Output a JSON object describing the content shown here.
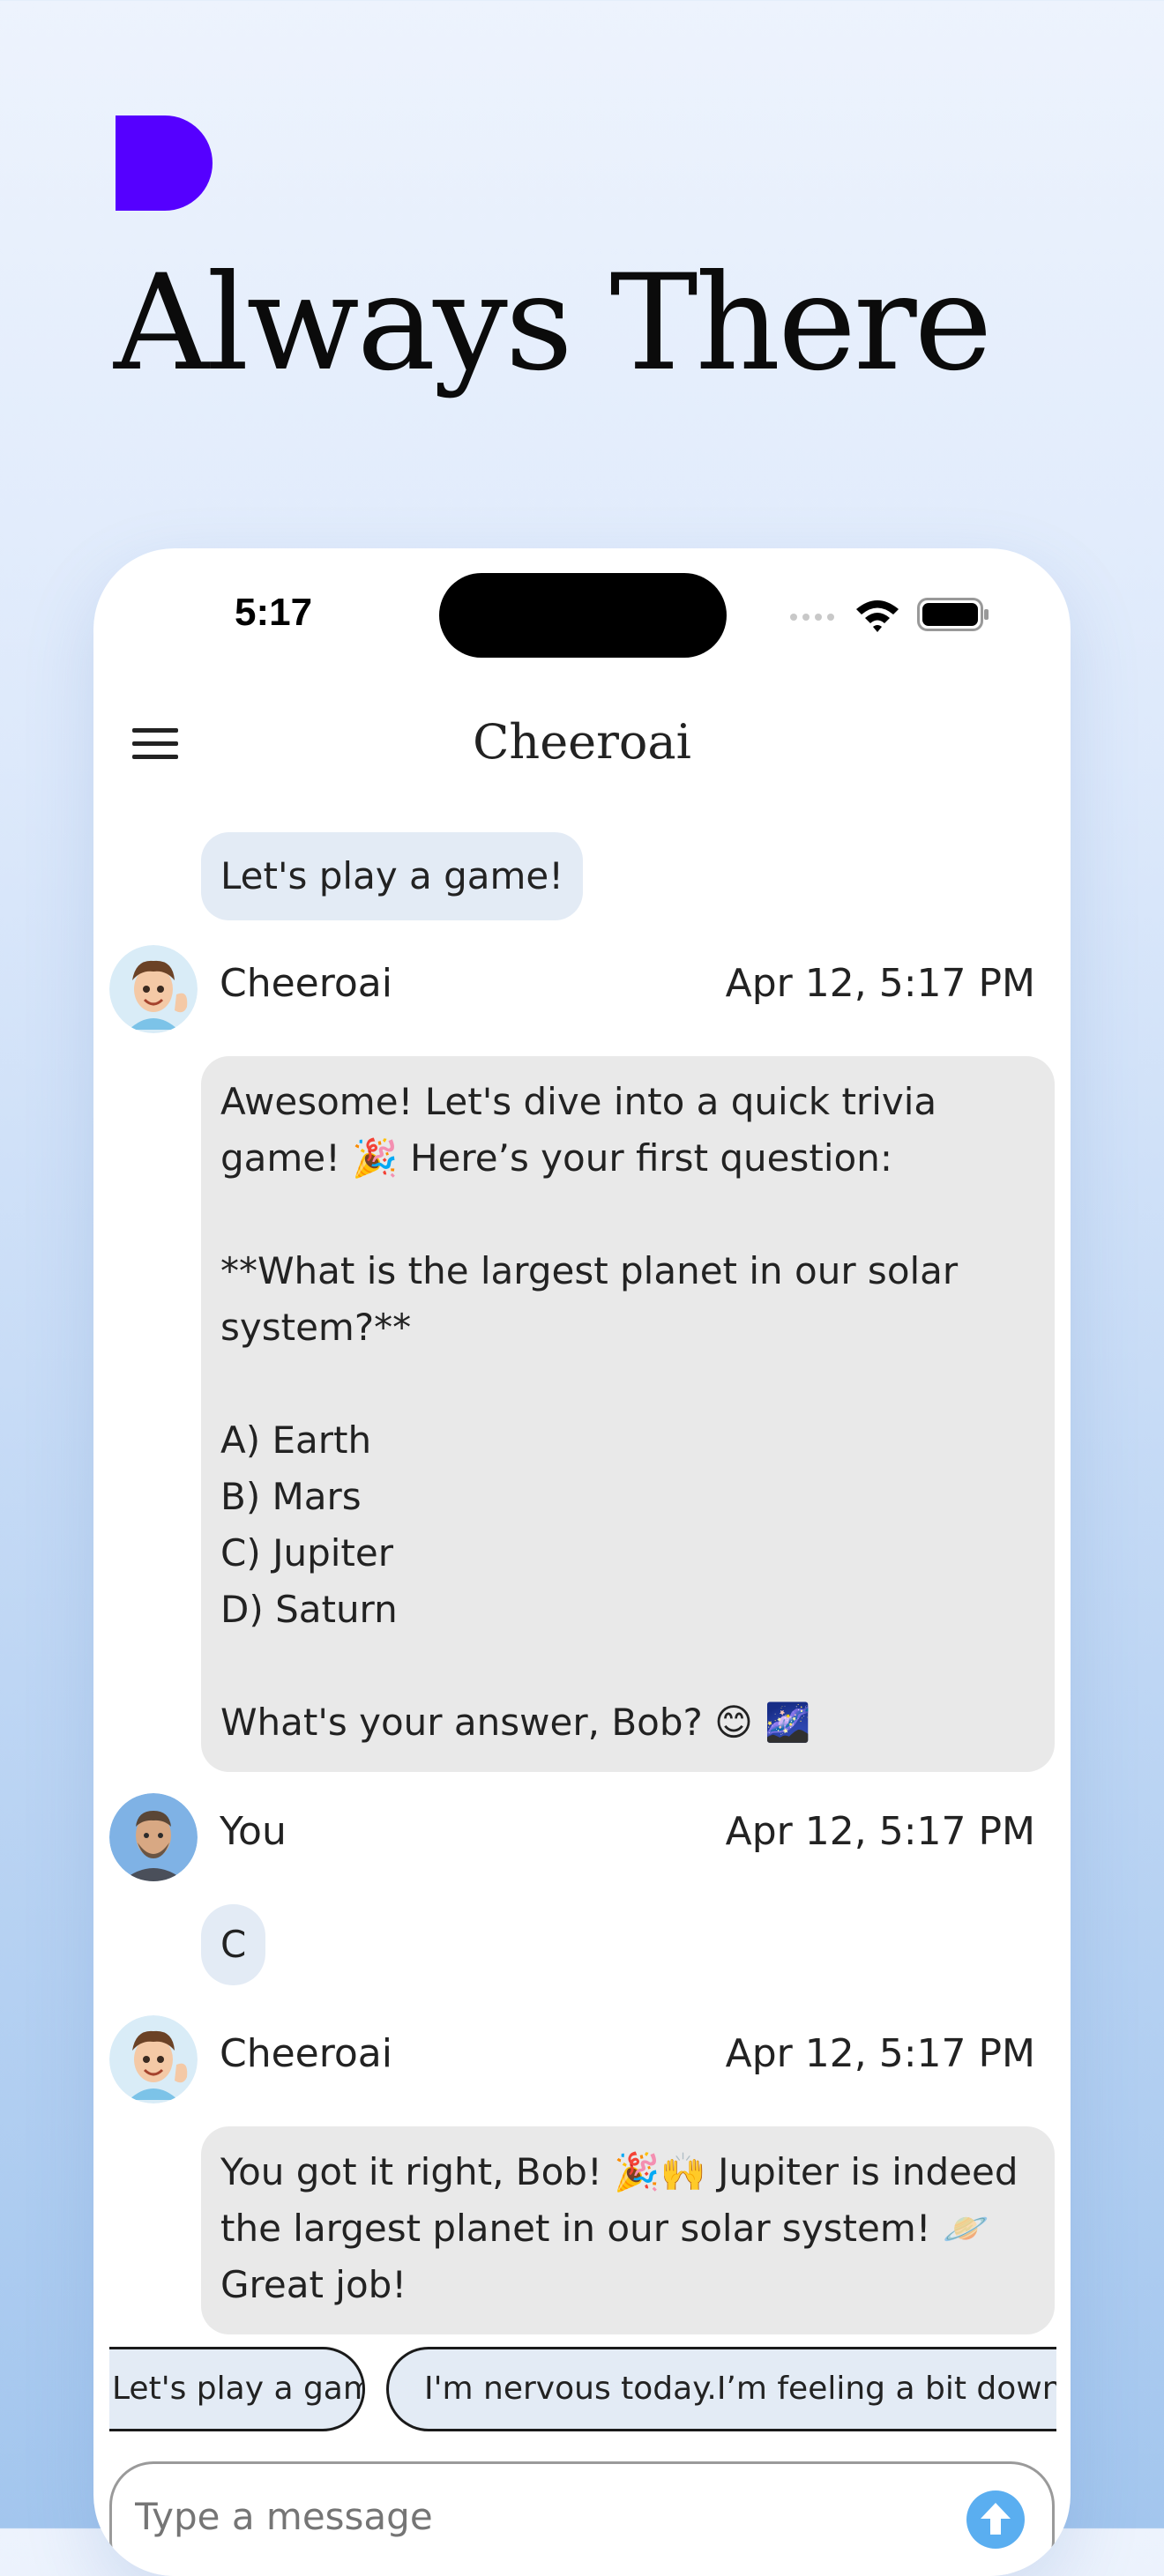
{
  "colors": {
    "brand_logo": "#5500ff",
    "user_bubble": "#e3ebf5",
    "bot_bubble": "#e9e9e9",
    "send_button": "#5aaef0"
  },
  "hero": {
    "title": "Always There"
  },
  "status_bar": {
    "time": "5:17"
  },
  "app_bar": {
    "title": "Cheeroai",
    "menu_icon": "hamburger-menu-icon"
  },
  "chat": {
    "messages": [
      {
        "type": "user",
        "text": "Let's play a game!"
      },
      {
        "type": "bot",
        "sender": "Cheeroai",
        "time": "Apr 12, 5:17 PM",
        "text": "Awesome! Let's dive into a quick trivia game! 🎉 Here’s your first question:\n\n**What is the largest planet in our solar system?**\n\nA) Earth\nB) Mars\nC) Jupiter\nD) Saturn\n\nWhat's your answer, Bob? 😊 🌌"
      },
      {
        "type": "user",
        "sender": "You",
        "time": "Apr 12, 5:17 PM",
        "text": "C"
      },
      {
        "type": "bot",
        "sender": "Cheeroai",
        "time": "Apr 12, 5:17 PM",
        "text": "You got it right, Bob! 🎉🙌 Jupiter is indeed the largest planet in our solar system! 🪐 Great job!"
      }
    ]
  },
  "suggestions": [
    "Let's play a game!",
    "I'm nervous today.",
    "I’m feeling a bit down today."
  ],
  "composer": {
    "placeholder": "Type a message",
    "send_icon": "arrow-up-icon"
  }
}
